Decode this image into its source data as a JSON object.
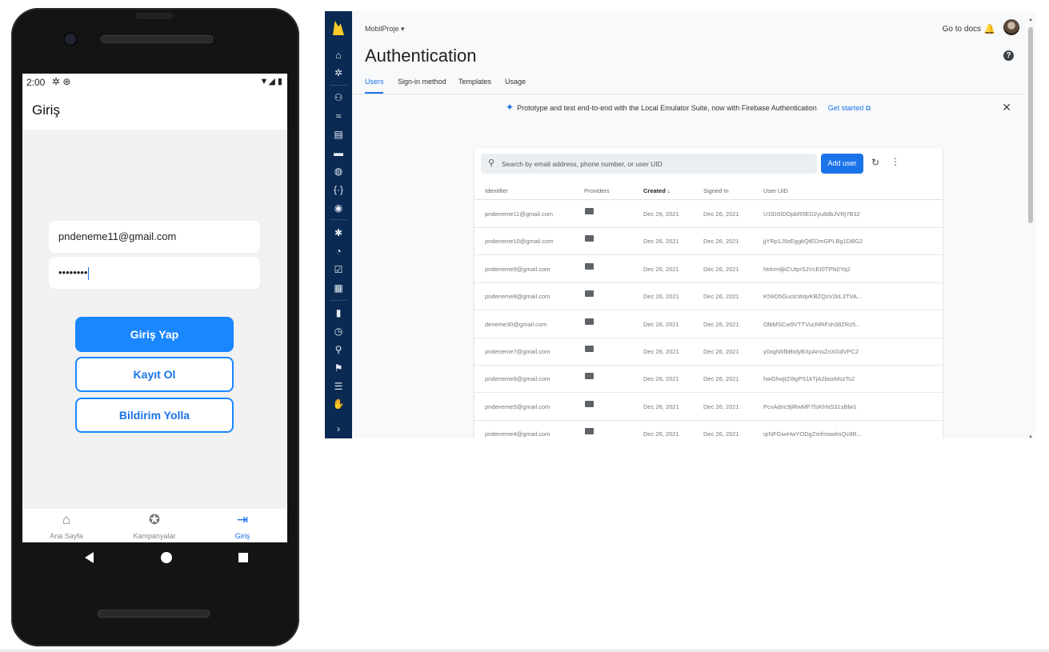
{
  "phone": {
    "status": {
      "time": "2:00",
      "left_icons": "✲ ⊛",
      "right_icons": "▼◢ ▮"
    },
    "appbar": {
      "title": "Giriş"
    },
    "email_value": "pndeneme11@gmail.com",
    "password_value": "••••••••",
    "buttons": {
      "login": "Giriş Yap",
      "register": "Kayıt Ol",
      "notify": "Bildirim Yolla"
    },
    "bottom_nav": [
      {
        "label": "Ana Sayfa",
        "icon": "home-icon",
        "glyph": "⌂"
      },
      {
        "label": "Kampanyalar",
        "icon": "discount-badge-icon",
        "glyph": "✪"
      },
      {
        "label": "Giriş",
        "icon": "login-icon",
        "glyph": "⇥"
      }
    ]
  },
  "console": {
    "project": "MobilProje ▾",
    "go_to_docs": "Go to docs",
    "title": "Authentication",
    "tabs": [
      "Users",
      "Sign-in method",
      "Templates",
      "Usage"
    ],
    "active_tab": "Users",
    "banner": {
      "text": "Prototype and test end-to-end with the Local Emulator Suite, now with Firebase Authentication",
      "link": "Get started ⧉"
    },
    "search_placeholder": "Search by email address, phone number, or user UID",
    "add_user": "Add user",
    "columns": [
      "Identifier",
      "Providers",
      "Created ↓",
      "Signed In",
      "User UID"
    ],
    "rows": [
      {
        "identifier": "pndeneme11@gmail.com",
        "created": "Dec 26, 2021",
        "signed_in": "Dec 26, 2021",
        "uid": "U1lDSlDOpbR0ED2yu8dbJVRj7B32"
      },
      {
        "identifier": "pndeneme10@gmail.com",
        "created": "Dec 26, 2021",
        "signed_in": "Dec 26, 2021",
        "uid": "jjYRp1J9zEggkQtEDmGPLBg1DBG2"
      },
      {
        "identifier": "pndeneme9@gmail.com",
        "created": "Dec 26, 2021",
        "signed_in": "Dec 26, 2021",
        "uid": "htrkrmljkCUtprSJVcEI0TPN0Yq2"
      },
      {
        "identifier": "pndeneme8@gmail.com",
        "created": "Dec 26, 2021",
        "signed_in": "Dec 26, 2021",
        "uid": "K59O5GuclcWqvKBZQsV2kL3TVA..."
      },
      {
        "identifier": "deneme30@gmail.com",
        "created": "Dec 26, 2021",
        "signed_in": "Dec 26, 2021",
        "uid": "OlbMSCw9VTTVucMRFsh38ZRz5..."
      },
      {
        "identifier": "pndeneme7@gmail.com",
        "created": "Dec 26, 2021",
        "signed_in": "Dec 26, 2021",
        "uid": "y0xgN6fbBtdyBXpAmsZnXGdVPC2"
      },
      {
        "identifier": "pndeneme6@gmail.com",
        "created": "Dec 26, 2021",
        "signed_in": "Dec 26, 2021",
        "uid": "hwGhwjtZi9gPS1kTjA2boxMszTs2"
      },
      {
        "identifier": "pndeneme5@gmail.com",
        "created": "Dec 26, 2021",
        "signed_in": "Dec 26, 2021",
        "uid": "PcvAdnc9jlRwMF7fsKhNS31sBlw1"
      },
      {
        "identifier": "pndeneme4@gmail.com",
        "created": "Dec 26, 2021",
        "signed_in": "Dec 26, 2021",
        "uid": "qrNFGiwHwYODgZmfmowlmQc8R..."
      }
    ],
    "rail_icons": [
      "home-icon",
      "settings-icon",
      "users-icon",
      "hosting-icon",
      "database-icon",
      "storage-icon",
      "globe-icon",
      "functions-icon",
      "ml-icon",
      "crashlytics-icon",
      "performance-icon",
      "test-lab-icon",
      "app-distribution-icon",
      "analytics-icon",
      "realtime-icon",
      "dynamic-links-icon",
      "remote-config-icon",
      "ab-testing-icon",
      "messaging-icon",
      "expand-icon"
    ],
    "colors": {
      "rail": "#0b2a53",
      "accent": "#1a73e8",
      "firebase": "#ffca28"
    }
  }
}
